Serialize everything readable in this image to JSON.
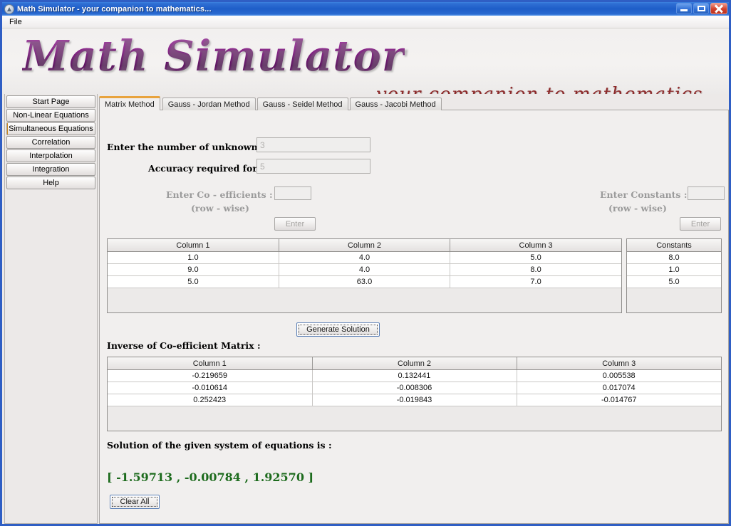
{
  "window": {
    "title": "Math Simulator - your companion to mathematics...",
    "icon": "app-icon",
    "buttons": {
      "minimize": "minimize-icon",
      "maximize": "maximize-icon",
      "close": "close-icon"
    }
  },
  "menubar": {
    "items": [
      "File"
    ]
  },
  "banner": {
    "logo": "Math Simulator",
    "tagline": "- your companion to mathematics . . .",
    "logo_color": "#8f2a8f",
    "tagline_color": "#8d2b2b"
  },
  "sidebar": {
    "selected": "Simultaneous Equations",
    "accent_color": "#e8a33d",
    "items": [
      {
        "label": "Start Page"
      },
      {
        "label": "Non-Linear Equations"
      },
      {
        "label": "Simultaneous Equations"
      },
      {
        "label": "Correlation"
      },
      {
        "label": "Interpolation"
      },
      {
        "label": "Integration"
      },
      {
        "label": "Help"
      }
    ]
  },
  "tabs": {
    "active_index": 0,
    "items": [
      {
        "label": "Matrix Method"
      },
      {
        "label": "Gauss - Jordan Method"
      },
      {
        "label": "Gauss - Seidel Method"
      },
      {
        "label": "Gauss - Jacobi Method"
      }
    ]
  },
  "form": {
    "unknowns_label": "Enter the number of unknowns :",
    "unknowns_value": "3",
    "accuracy_label": "Accuracy required for :",
    "accuracy_value": "5",
    "coeff_label": "Enter Co - efficients  :",
    "coeff_sub_label": "(row - wise)",
    "coeff_value": "",
    "coeff_enter_button": "Enter",
    "constants_label": "Enter Constants :",
    "constants_sub_label": "(row - wise)",
    "constants_value": "",
    "constants_enter_button": "Enter"
  },
  "matrix_table": {
    "headers": [
      "Column 1",
      "Column 2",
      "Column 3"
    ],
    "rows": [
      [
        "1.0",
        "4.0",
        "5.0"
      ],
      [
        "9.0",
        "4.0",
        "8.0"
      ],
      [
        "5.0",
        "63.0",
        "7.0"
      ]
    ]
  },
  "constants_table": {
    "headers": [
      "Constants"
    ],
    "rows": [
      [
        "8.0"
      ],
      [
        "1.0"
      ],
      [
        "5.0"
      ]
    ]
  },
  "generate_button": "Generate Solution",
  "inverse": {
    "title": "Inverse of Co-efficient Matrix :",
    "headers": [
      "Column 1",
      "Column 2",
      "Column 3"
    ],
    "rows": [
      [
        "-0.219659",
        "0.132441",
        "0.005538"
      ],
      [
        "-0.010614",
        "-0.008306",
        "0.017074"
      ],
      [
        "0.252423",
        "-0.019843",
        "-0.014767"
      ]
    ]
  },
  "solution": {
    "title": "Solution of the given system of equations is :",
    "open_bracket": "[",
    "values": [
      "-1.59713",
      "-0.00784",
      "1.92570"
    ],
    "close_bracket": "]",
    "separator": ",",
    "text": "[ -1.59713 , -0.00784 , 1.92570 ]",
    "color": "#1d6b1d"
  },
  "clear_button": "Clear All"
}
